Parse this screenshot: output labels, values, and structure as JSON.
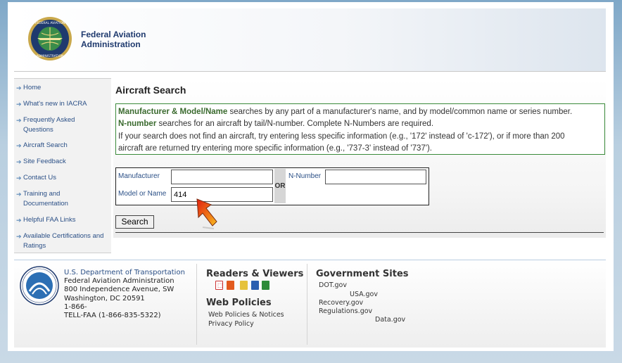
{
  "header": {
    "org_line1": "Federal Aviation",
    "org_line2": "Administration"
  },
  "sidebar": {
    "items": [
      {
        "label": "Home"
      },
      {
        "label": "What's new in IACRA"
      },
      {
        "label": "Frequently Asked Questions"
      },
      {
        "label": "Aircraft Search"
      },
      {
        "label": "Site Feedback"
      },
      {
        "label": "Contact Us"
      },
      {
        "label": "Training and Documentation"
      },
      {
        "label": "Helpful FAA Links"
      },
      {
        "label": "Available Certifications and Ratings"
      }
    ]
  },
  "main": {
    "title": "Aircraft Search",
    "info": {
      "line1_bold": "Manufacturer & Model/Name",
      "line1_rest": " searches by any part of a manufacturer's name, and by model/common name or series number.",
      "line2_bold": "N-number",
      "line2_rest": " searches for an aircraft by tail/N-number. Complete N-Numbers are required.",
      "line3": "If your search does not find an aircraft, try entering less specific information (e.g., '172' instead of 'c-172'), or if more than 200",
      "line4": "aircraft are returned try entering more specific information (e.g., '737-3' instead of '737')."
    },
    "form": {
      "manufacturer_label": "Manufacturer",
      "manufacturer_value": "",
      "model_label": "Model or Name",
      "model_value": "414",
      "or_label": "OR",
      "nnumber_label": "N-Number",
      "nnumber_value": ""
    },
    "search_button": "Search"
  },
  "footer": {
    "dot": {
      "dept": "U.S. Department of Transportation",
      "agency": "Federal Aviation Administration",
      "address1": "800 Independence Avenue, SW",
      "address2": "Washington, DC 20591",
      "phone1": "1-866-",
      "phone2": "TELL-FAA (1-866-835-5322)"
    },
    "readers_title": "Readers & Viewers",
    "viewer_icons": [
      "pdf-icon",
      "powerpoint-icon",
      "zip-icon",
      "word-icon",
      "excel-icon"
    ],
    "web_policies_title": "Web Policies",
    "web_policies_links": [
      "Web Policies & Notices",
      "Privacy Policy"
    ],
    "gov_sites_title": "Government Sites",
    "gov_sites_links": [
      "DOT.gov",
      "USA.gov",
      "Recovery.gov",
      "Regulations.gov",
      "Data.gov"
    ]
  },
  "colors": {
    "link": "#2a4f86",
    "info_border": "#3a8a3a",
    "header_text": "#1f3a6e"
  }
}
